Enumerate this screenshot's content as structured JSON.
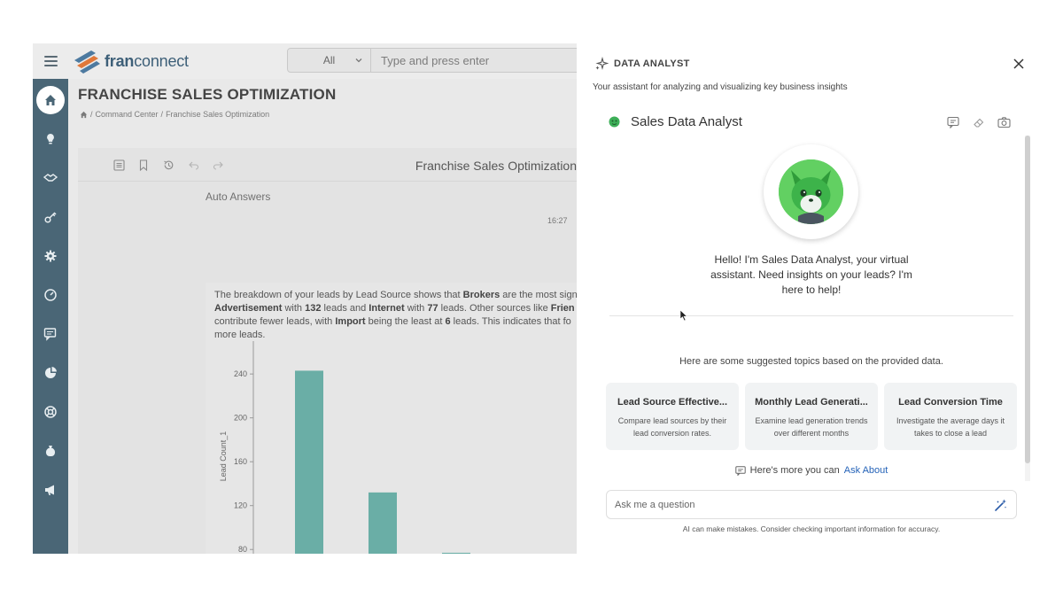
{
  "app": {
    "logo_text_bold": "fran",
    "logo_text_rest": "connect"
  },
  "search": {
    "scope": "All",
    "placeholder": "Type and press enter"
  },
  "sidebar": {
    "items": [
      {
        "icon": "home-icon"
      },
      {
        "icon": "lightbulb-icon"
      },
      {
        "icon": "handshake-icon"
      },
      {
        "icon": "key-icon"
      },
      {
        "icon": "gear-icon"
      },
      {
        "icon": "dashboard-icon"
      },
      {
        "icon": "chat-icon"
      },
      {
        "icon": "pie-icon"
      },
      {
        "icon": "support-icon"
      },
      {
        "icon": "money-bag-icon"
      },
      {
        "icon": "megaphone-icon"
      }
    ]
  },
  "page": {
    "title": "FRANCHISE SALES OPTIMIZATION",
    "breadcrumb": [
      "Command Center",
      "Franchise Sales Optimization"
    ],
    "breadcrumb_sep": "/"
  },
  "card": {
    "title": "Franchise Sales Optimization",
    "section": "Auto Answers",
    "timestamp": "16:27",
    "answer_lines": [
      {
        "parts": [
          {
            "t": "The breakdown of your leads by Lead Source shows that ",
            "b": false
          },
          {
            "t": "Brokers",
            "b": true
          },
          {
            "t": " are the most signi",
            "b": false
          }
        ]
      },
      {
        "parts": [
          {
            "t": "Advertisement",
            "b": true
          },
          {
            "t": " with ",
            "b": false
          },
          {
            "t": "132",
            "b": true
          },
          {
            "t": " leads and ",
            "b": false
          },
          {
            "t": "Internet",
            "b": true
          },
          {
            "t": " with ",
            "b": false
          },
          {
            "t": "77",
            "b": true
          },
          {
            "t": " leads. Other sources like ",
            "b": false
          },
          {
            "t": "Frien",
            "b": true
          }
        ]
      },
      {
        "parts": [
          {
            "t": "contribute fewer leads, with ",
            "b": false
          },
          {
            "t": "Import",
            "b": true
          },
          {
            "t": " being the least at ",
            "b": false
          },
          {
            "t": "6",
            "b": true
          },
          {
            "t": " leads. This indicates that fo",
            "b": false
          }
        ]
      },
      {
        "parts": [
          {
            "t": "more leads.",
            "b": false
          }
        ]
      }
    ]
  },
  "chart_data": {
    "type": "bar",
    "ylabel": "Lead Count_1",
    "yticks": [
      80,
      120,
      160,
      200,
      240
    ],
    "ylim": [
      60,
      270
    ],
    "values": [
      243,
      132,
      77
    ],
    "color": "#6aaea6"
  },
  "assistant": {
    "header": "DATA ANALYST",
    "subtitle": "Your assistant for analyzing and visualizing key business insights",
    "agent_name": "Sales Data Analyst",
    "greeting": "Hello! I'm Sales Data Analyst, your virtual assistant. Need insights on your leads? I'm here to help!",
    "topics_intro": "Here are some suggested topics based on the provided data.",
    "topics": [
      {
        "title": "Lead Source Effective...",
        "desc": "Compare lead sources by their lead conversion rates."
      },
      {
        "title": "Monthly Lead Generati...",
        "desc": "Examine lead generation trends over different months"
      },
      {
        "title": "Lead Conversion Time",
        "desc": "Investigate the average days it takes to close a lead"
      }
    ],
    "more_prefix": "Here's more you can",
    "more_link": "Ask About",
    "input_placeholder": "Ask me a question",
    "disclaimer": "AI can make mistakes. Consider checking important information for accuracy."
  },
  "colors": {
    "sidebar": "#4a6676",
    "accent_link": "#2563b8",
    "bar": "#6aaea6"
  }
}
